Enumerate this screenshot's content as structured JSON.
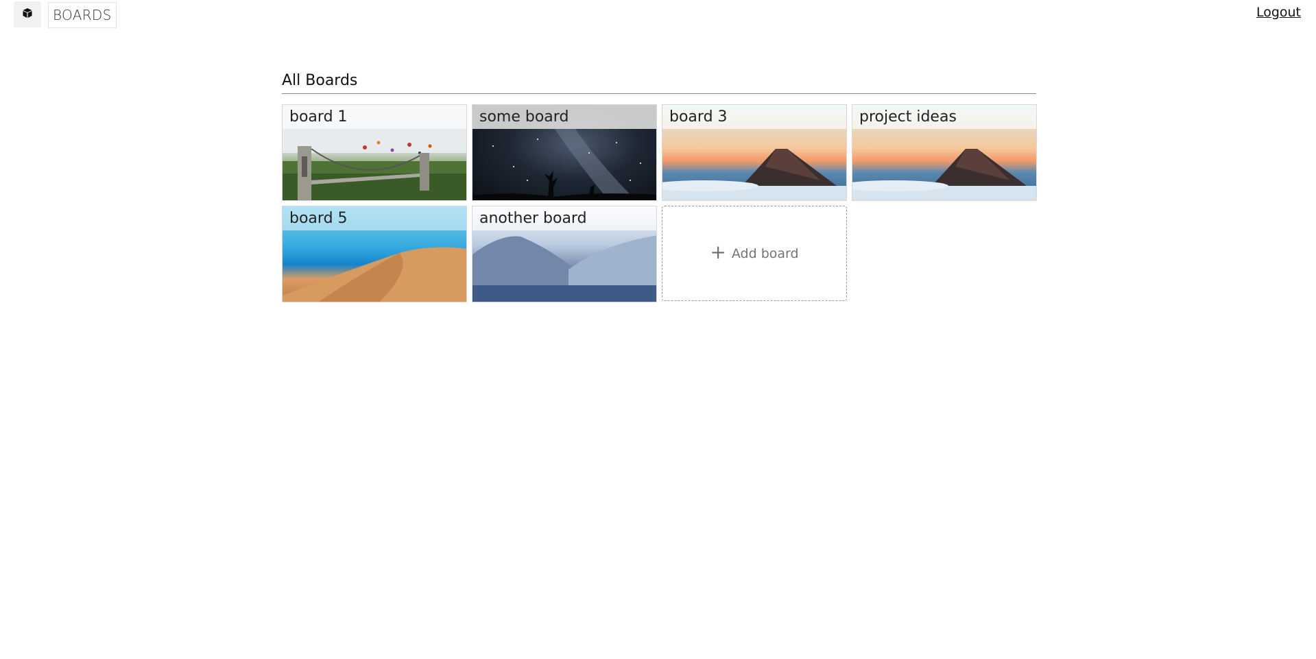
{
  "header": {
    "logo_icon": "box-icon",
    "brand": "BOARDS",
    "logout_label": "Logout"
  },
  "main": {
    "section_title": "All Boards",
    "boards": [
      {
        "title": "board 1",
        "image": "suspension-bridge-balloons"
      },
      {
        "title": "some board",
        "image": "milky-way-night-sky"
      },
      {
        "title": "board 3",
        "image": "volcano-above-clouds"
      },
      {
        "title": "project ideas",
        "image": "volcano-above-clouds"
      },
      {
        "title": "board 5",
        "image": "desert-dune"
      },
      {
        "title": "another board",
        "image": "misty-mountain-lake"
      }
    ],
    "add_board": {
      "icon": "plus-icon",
      "label": "Add board"
    }
  }
}
